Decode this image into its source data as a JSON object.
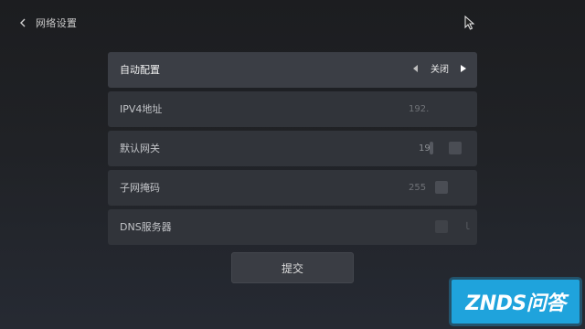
{
  "header": {
    "title": "网络设置",
    "back_icon": "chevron-left-icon"
  },
  "settings": {
    "auto_config": {
      "label": "自动配置",
      "value": "关闭"
    },
    "ipv4": {
      "label": "IPV4地址",
      "value": "192."
    },
    "gateway": {
      "label": "默认网关",
      "value": "19"
    },
    "subnet_mask": {
      "label": "子网掩码",
      "value": "255"
    },
    "dns": {
      "label": "DNS服务器",
      "mark": "ｌ"
    }
  },
  "submit_label": "提交",
  "watermark": {
    "text": "ZNDS问答"
  },
  "colors": {
    "background_top": "#1c1d20",
    "background_bottom": "#262a33",
    "row_bg": "#31343a",
    "row_active_bg": "#3b3e45",
    "button_bg": "#3a3d44",
    "watermark_bg": "#1fa3dc"
  }
}
